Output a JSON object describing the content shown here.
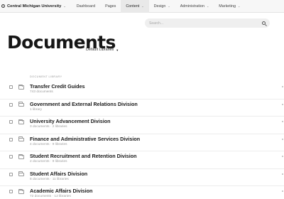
{
  "topbar": {
    "site_name": "Central Michigan University",
    "nav": [
      {
        "label": "Dashboard",
        "has_caret": false
      },
      {
        "label": "Pages",
        "has_caret": false
      },
      {
        "label": "Content",
        "has_caret": true,
        "active": true
      },
      {
        "label": "Design",
        "has_caret": true
      },
      {
        "label": "Administration",
        "has_caret": true
      },
      {
        "label": "Marketing",
        "has_caret": true
      }
    ],
    "caret_glyph": "⌄"
  },
  "search": {
    "placeholder": "Search..."
  },
  "page": {
    "title": "Documents",
    "library_selector": "Default Libraries"
  },
  "list": {
    "section_label": "DOCUMENT LIBRARY",
    "items": [
      {
        "title": "Transfer Credit Guides",
        "subtitle": "743 documents"
      },
      {
        "title": "Government and External Relations Division",
        "subtitle": "1 library"
      },
      {
        "title": "University Advancement Division",
        "subtitle": "3 documents · 2 libraries"
      },
      {
        "title": "Finance and Administrative Services Division",
        "subtitle": "4 documents · 9 libraries"
      },
      {
        "title": "Student Recruitment and Retention Division",
        "subtitle": "2 documents · 9 libraries"
      },
      {
        "title": "Student Affairs Division",
        "subtitle": "8 documents · 11 libraries"
      },
      {
        "title": "Academic Affairs Division",
        "subtitle": "72 documents · 12 libraries"
      }
    ]
  },
  "colors": {
    "topbar_bg": "#f7f7f7",
    "active_tab_bg": "#e9e9e9",
    "search_bg": "#efefef",
    "muted_text": "#9b9b9b"
  }
}
